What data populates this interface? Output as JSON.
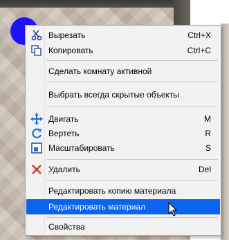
{
  "context_menu": {
    "items": [
      {
        "label": "Вырезать",
        "shortcut": "Ctrl+X",
        "icon": "scissors-icon"
      },
      {
        "label": "Копировать",
        "shortcut": "Ctrl+C",
        "icon": "copy-icon"
      },
      {
        "label": "Сделать комнату активной"
      },
      {
        "label": "Выбрать всегда скрытые объекты"
      },
      {
        "label": "Двигать",
        "shortcut": "M",
        "icon": "move-icon"
      },
      {
        "label": "Вертеть",
        "shortcut": "R",
        "icon": "rotate-icon"
      },
      {
        "label": "Масштабировать",
        "shortcut": "S",
        "icon": "scale-icon"
      },
      {
        "label": "Удалить",
        "shortcut": "Del",
        "icon": "delete-icon"
      },
      {
        "label": "Редактировать копию материала"
      },
      {
        "label": "Редактировать материал",
        "highlighted": true
      },
      {
        "label": "Свойства"
      }
    ]
  },
  "colors": {
    "highlight": "#0a64f0",
    "menu_bg": "#f2f2f2",
    "marker_dot": "#1f10ff",
    "delete_icon": "#d9342b",
    "move_icon": "#1e6fd9"
  }
}
